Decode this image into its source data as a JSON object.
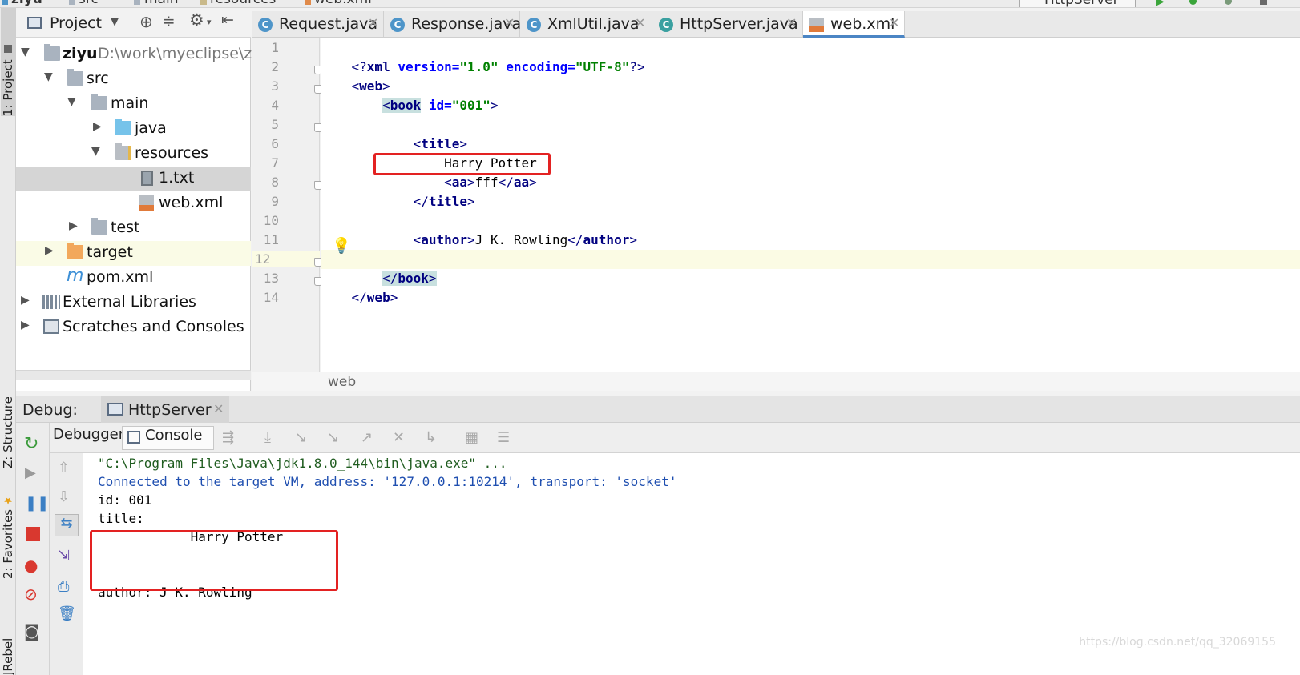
{
  "breadcrumb_top": [
    "ziyu",
    "src",
    "main",
    "resources",
    "web.xml"
  ],
  "top_right_run_config": "HttpServer",
  "left_stripe": {
    "project": "1: Project",
    "structure": "Z: Structure",
    "favorites": "2: Favorites",
    "jrebel": "JRebel"
  },
  "project_panel": {
    "title": "Project",
    "tree": [
      {
        "label": "ziyu",
        "path": "D:\\work\\myeclipse\\ziyu",
        "expanded": true,
        "icon": "module-folder-icon"
      },
      {
        "label": "src",
        "expanded": true,
        "icon": "folder-icon"
      },
      {
        "label": "main",
        "expanded": true,
        "icon": "folder-icon"
      },
      {
        "label": "java",
        "expanded": false,
        "icon": "source-folder-icon"
      },
      {
        "label": "resources",
        "expanded": true,
        "icon": "resources-folder-icon"
      },
      {
        "label": "1.txt",
        "icon": "text-file-icon",
        "selected": true
      },
      {
        "label": "web.xml",
        "icon": "xml-file-icon"
      },
      {
        "label": "test",
        "expanded": false,
        "icon": "folder-icon"
      },
      {
        "label": "target",
        "expanded": false,
        "icon": "excluded-folder-icon"
      },
      {
        "label": "pom.xml",
        "icon": "maven-icon"
      },
      {
        "label": "External Libraries",
        "expanded": false,
        "icon": "libraries-icon"
      },
      {
        "label": "Scratches and Consoles",
        "expanded": false,
        "icon": "scratches-icon"
      }
    ]
  },
  "editor_tabs": [
    {
      "label": "Request.java",
      "icon": "C"
    },
    {
      "label": "Response.java",
      "icon": "C"
    },
    {
      "label": "XmlUtil.java",
      "icon": "C"
    },
    {
      "label": "HttpServer.java",
      "icon": "C"
    },
    {
      "label": "web.xml",
      "icon": "xml",
      "active": true
    }
  ],
  "editor": {
    "line_numbers": [
      "1",
      "2",
      "3",
      "4",
      "5",
      "6",
      "7",
      "8",
      "9",
      "10",
      "11",
      "12",
      "13",
      "14"
    ],
    "code": {
      "l1": {
        "open": "<?",
        "name": "xml",
        "a1": " version=",
        "v1": "\"1.0\"",
        "a2": " encoding=",
        "v2": "\"UTF-8\"",
        "close": "?>"
      },
      "l2": {
        "open": "<",
        "name": "web",
        "close": ">"
      },
      "l3": {
        "indent": "    ",
        "open": "<",
        "name": "book",
        "attr": " id=",
        "val": "\"001\"",
        "close": ">"
      },
      "l5": {
        "indent": "        ",
        "open": "<",
        "name": "title",
        "close": ">"
      },
      "l6": {
        "text": "            Harry Potter"
      },
      "l7": {
        "indent": "            ",
        "open": "<",
        "name": "aa",
        "close": ">",
        "text": "fff",
        "eopen": "</",
        "ename": "aa",
        "eclose": ">"
      },
      "l8": {
        "indent": "        ",
        "open": "</",
        "name": "title",
        "close": ">"
      },
      "l10": {
        "indent": "        ",
        "open": "<",
        "name": "author",
        "close": ">",
        "text": "J K. Rowling",
        "eopen": "</",
        "ename": "author",
        "eclose": ">"
      },
      "l12": {
        "indent": "    ",
        "open": "</",
        "name": "book",
        "close": ">"
      },
      "l13": {
        "open": "</",
        "name": "web",
        "close": ">"
      }
    },
    "breadcrumb": "web"
  },
  "debug": {
    "label": "Debug:",
    "session_tab": "HttpServer",
    "subtabs": {
      "debugger": "Debugger",
      "console": "Console"
    },
    "console_lines": [
      "\"C:\\Program Files\\Java\\jdk1.8.0_144\\bin\\java.exe\" ...",
      "Connected to the target VM, address: '127.0.0.1:10214', transport: 'socket'",
      "id: 001",
      "title:",
      "            Harry Potter",
      "",
      "",
      "author: J K. Rowling"
    ]
  },
  "watermark": "https://blog.csdn.net/qq_32069155",
  "colors": {
    "highlight_box": "#e32222",
    "tab_active_border": "#4b85c4"
  }
}
